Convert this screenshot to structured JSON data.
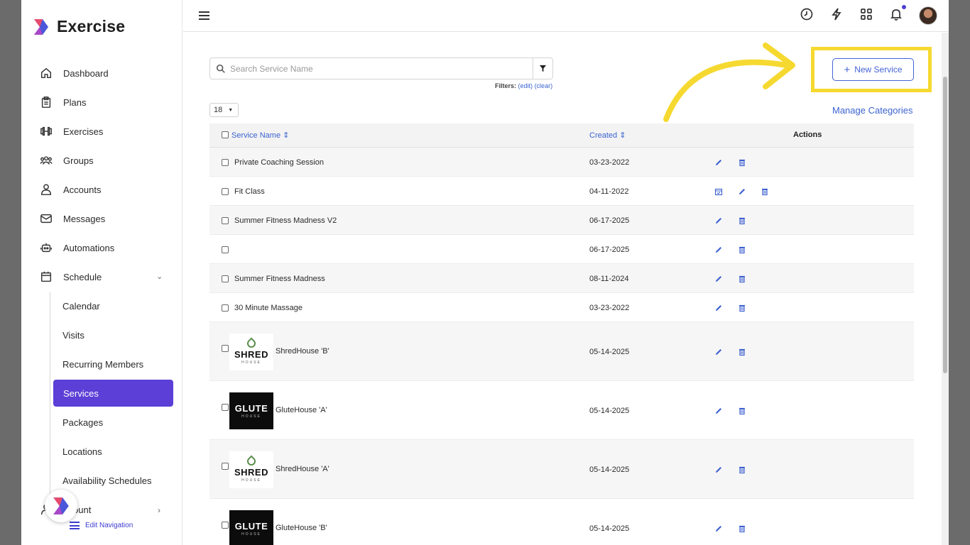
{
  "app": {
    "title": "Exercise"
  },
  "sidebar": {
    "items": [
      {
        "label": "Dashboard",
        "icon": "home-icon"
      },
      {
        "label": "Plans",
        "icon": "clipboard-icon"
      },
      {
        "label": "Exercises",
        "icon": "dumbbell-icon"
      },
      {
        "label": "Groups",
        "icon": "group-icon"
      },
      {
        "label": "Accounts",
        "icon": "user-icon"
      },
      {
        "label": "Messages",
        "icon": "mail-icon"
      },
      {
        "label": "Automations",
        "icon": "robot-icon"
      },
      {
        "label": "Schedule",
        "icon": "calendar-icon"
      }
    ],
    "schedule_sub": [
      "Calendar",
      "Visits",
      "Recurring Members",
      "Services",
      "Packages",
      "Locations",
      "Availability Schedules"
    ],
    "active": "Services",
    "account_partial": "ount",
    "edit_navigation": "Edit Navigation"
  },
  "search": {
    "placeholder": "Search Service Name"
  },
  "filters": {
    "label": "Filters:",
    "edit": "(edit)",
    "clear": "(clear)"
  },
  "per_page": "18",
  "new_service_label": "New Service",
  "manage_categories": "Manage Categories",
  "table": {
    "columns": {
      "name": "Service Name",
      "created": "Created",
      "actions": "Actions"
    },
    "rows": [
      {
        "name": "Private Coaching Session",
        "created": "03-23-2022"
      },
      {
        "name": "Fit Class",
        "created": "04-11-2022"
      },
      {
        "name": "Summer Fitness Madness V2",
        "created": "06-17-2025"
      },
      {
        "name": "",
        "created": "06-17-2025"
      },
      {
        "name": "Summer Fitness Madness",
        "created": "08-11-2024"
      },
      {
        "name": "30 Minute Massage",
        "created": "03-23-2022"
      },
      {
        "name": "ShredHouse 'B'",
        "created": "05-14-2025",
        "thumb": {
          "style": "light",
          "text": "SHRED",
          "sub": "HOUSE"
        }
      },
      {
        "name": "GluteHouse 'A'",
        "created": "05-14-2025",
        "thumb": {
          "style": "dark",
          "text": "GLUTE",
          "sub": "HOUSE"
        }
      },
      {
        "name": "ShredHouse 'A'",
        "created": "05-14-2025",
        "thumb": {
          "style": "light",
          "text": "SHRED",
          "sub": "HOUSE"
        }
      },
      {
        "name": "GluteHouse 'B'",
        "created": "05-14-2025",
        "thumb": {
          "style": "dark",
          "text": "GLUTE",
          "sub": "HOUSE"
        }
      }
    ]
  },
  "colors": {
    "accent": "#5b3fd6",
    "link": "#3b63d0",
    "highlight": "#f6d930"
  }
}
